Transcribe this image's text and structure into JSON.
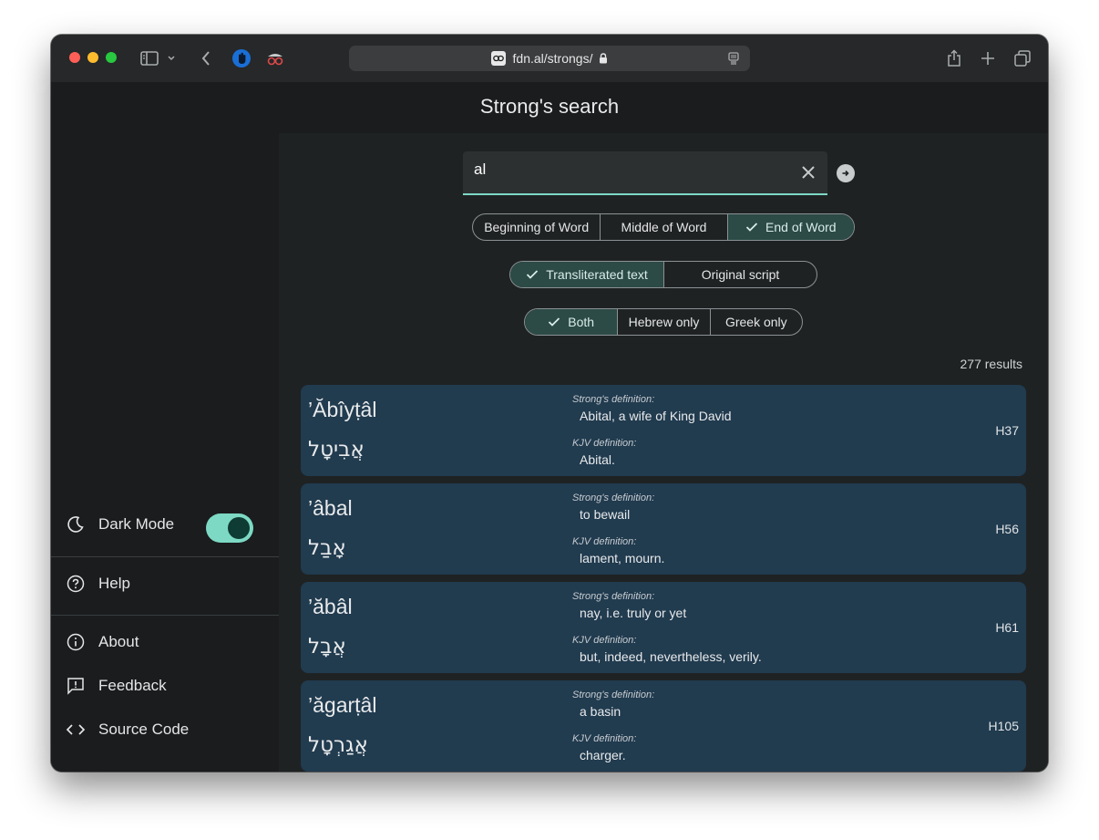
{
  "browser": {
    "url": "fdn.al/strongs/"
  },
  "page": {
    "title": "Strong's search"
  },
  "sidebar": {
    "dark_mode_label": "Dark Mode",
    "dark_mode_on": true,
    "items": [
      {
        "label": "Help",
        "icon": "help-circle-icon"
      },
      {
        "label": "About",
        "icon": "info-icon"
      },
      {
        "label": "Feedback",
        "icon": "feedback-icon"
      },
      {
        "label": "Source Code",
        "icon": "code-icon"
      }
    ]
  },
  "search": {
    "value": "al",
    "placeholder": ""
  },
  "filters": {
    "position": [
      {
        "label": "Beginning of Word",
        "selected": false
      },
      {
        "label": "Middle of Word",
        "selected": false
      },
      {
        "label": "End of Word",
        "selected": true
      }
    ],
    "script": [
      {
        "label": "Transliterated text",
        "selected": true
      },
      {
        "label": "Original script",
        "selected": false
      }
    ],
    "language": [
      {
        "label": "Both",
        "selected": true
      },
      {
        "label": "Hebrew only",
        "selected": false
      },
      {
        "label": "Greek only",
        "selected": false
      }
    ]
  },
  "results": {
    "count_text": "277 results",
    "strongs_label": "Strong's definition:",
    "kjv_label": "KJV definition:",
    "items": [
      {
        "translit": "’Ăbîyṭâl",
        "original": "אֲבִיטָל",
        "strongs_def": "Abital, a wife of King David",
        "kjv_def": "Abital.",
        "number": "H37"
      },
      {
        "translit": "’âbal",
        "original": "אָבַל",
        "strongs_def": "to bewail",
        "kjv_def": "lament, mourn.",
        "number": "H56"
      },
      {
        "translit": "’ăbâl",
        "original": "אֲבָל",
        "strongs_def": "nay, i.e. truly or yet",
        "kjv_def": "but, indeed, nevertheless, verily.",
        "number": "H61"
      },
      {
        "translit": "’ăgarṭâl",
        "original": "אֲגַרְטָל",
        "strongs_def": "a basin",
        "kjv_def": "charger.",
        "number": "H105"
      }
    ]
  },
  "colors": {
    "accent": "#7dd9c4",
    "card_bg": "#213b4f",
    "selected_segment": "#2c4a46"
  }
}
